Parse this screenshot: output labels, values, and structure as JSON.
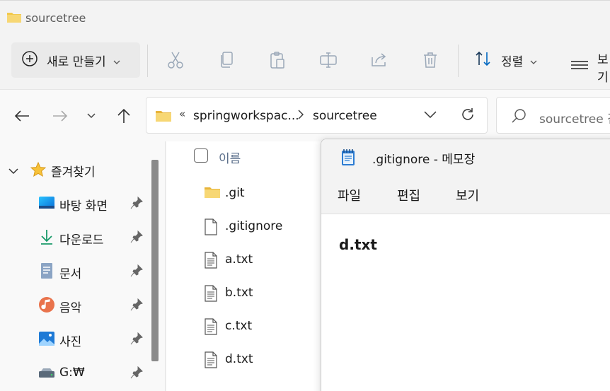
{
  "window": {
    "title": "sourcetree"
  },
  "toolbar": {
    "new_label": "새로 만들기",
    "sort_label": "정렬",
    "view_label": "보기",
    "icons": [
      "cut-icon",
      "copy-icon",
      "paste-icon",
      "rename-icon",
      "share-icon",
      "delete-icon"
    ]
  },
  "address": {
    "overflow": "«",
    "segments": [
      "springworkspac...",
      "sourcetree"
    ]
  },
  "search": {
    "placeholder": "sourcetree 검색"
  },
  "sidebar": {
    "favorites_label": "즐겨찾기",
    "items": [
      {
        "label": "바탕 화면",
        "icon": "desktop-icon"
      },
      {
        "label": "다운로드",
        "icon": "download-icon"
      },
      {
        "label": "문서",
        "icon": "documents-icon"
      },
      {
        "label": "음악",
        "icon": "music-icon"
      },
      {
        "label": "사진",
        "icon": "pictures-icon"
      },
      {
        "label": "G:₩",
        "icon": "drive-icon"
      }
    ]
  },
  "filelist": {
    "header_name": "이름",
    "files": [
      {
        "name": ".git",
        "type": "folder"
      },
      {
        "name": ".gitignore",
        "type": "file"
      },
      {
        "name": "a.txt",
        "type": "text"
      },
      {
        "name": "b.txt",
        "type": "text"
      },
      {
        "name": "c.txt",
        "type": "text"
      },
      {
        "name": "d.txt",
        "type": "text"
      }
    ]
  },
  "notepad": {
    "title": ".gitignore - 메모장",
    "menu": [
      "파일",
      "편집",
      "보기"
    ],
    "content": "d.txt"
  },
  "colors": {
    "folder": "#f2c94c",
    "accent": "#0067c0",
    "icon_gray": "#9aa8b8"
  }
}
